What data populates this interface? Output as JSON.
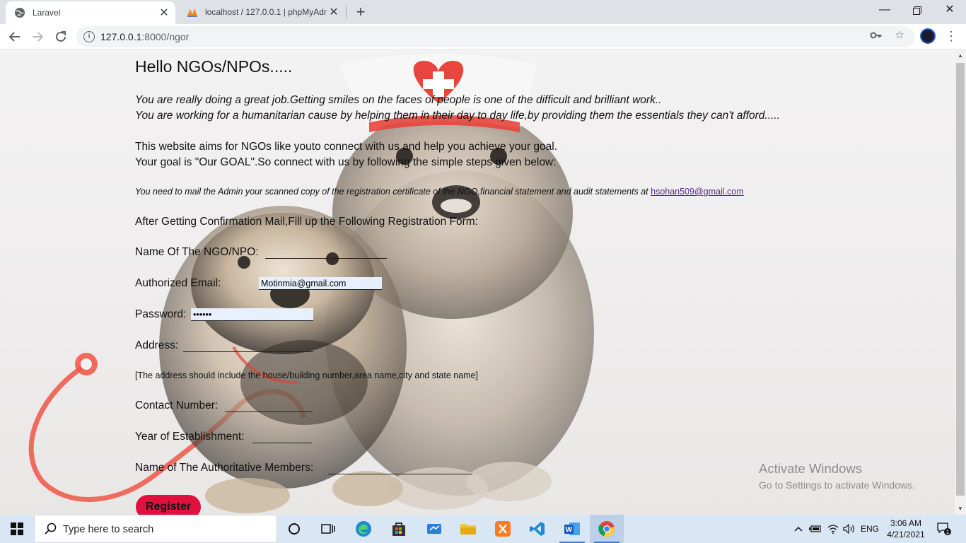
{
  "browser": {
    "tabs": [
      {
        "title": "Laravel",
        "icon": "globe-icon",
        "active": true
      },
      {
        "title": "localhost / 127.0.0.1 | phpMyAdm",
        "icon": "phpmyadmin-icon",
        "active": false
      }
    ],
    "url_host": "127.0.0.1",
    "url_path": ":8000/ngor"
  },
  "page": {
    "heading": "Hello NGOs/NPOs.....",
    "intro_line1": "You are really doing a great job.Getting smiles on the faces of people is one of the difficult and brilliant work..",
    "intro_line2": "You are working for a humanitarian cause by helping them in their day to day life,by providing them the essentials they can't afford.....",
    "aim_line1": "This website aims for NGOs like youto connect with us and help you achieve your goal.",
    "aim_line2": "Your goal is \"Our GOAL\".So connect with us by following the simple steps given below:",
    "mail_note": "You need to mail the Admin your scanned copy of the registration certificate of the NGO,financial statement and audit statements at",
    "admin_email": "hsohan509@gmail.com",
    "after_confirm": "After Getting Confirmation Mail,Fill up the Following Registration Form:",
    "fields": {
      "name_label": "Name Of The NGO/NPO:",
      "name_value": "",
      "email_label": "Authorized Email:",
      "email_value": "Motinmia@gmail.com",
      "password_label": "Password:",
      "password_value": "••••••",
      "address_label": "Address:",
      "address_value": "",
      "address_hint": "[The address should include the house/building number,area name,city and state name]",
      "contact_label": "Contact Number:",
      "contact_value": "",
      "year_label": "Year of Establishment:",
      "year_value": "",
      "members_label": "Name of The Authoritative Members:",
      "members_value": ""
    },
    "register_label": "Register"
  },
  "watermark": {
    "line1": "Activate Windows",
    "line2": "Go to Settings to activate Windows."
  },
  "taskbar": {
    "search_placeholder": "Type here to search",
    "language": "ENG",
    "time": "3:06 AM",
    "date": "4/21/2021",
    "notification_count": "1",
    "apps": [
      "cortana-icon",
      "task-view-icon",
      "edge-icon",
      "store-icon",
      "control-panel-icon",
      "file-explorer-icon",
      "xampp-icon",
      "vscode-icon",
      "word-icon",
      "chrome-icon"
    ]
  },
  "colors": {
    "register_button": "#e0103f",
    "link": "#5b2a86",
    "taskbar": "#d9e6f4"
  }
}
